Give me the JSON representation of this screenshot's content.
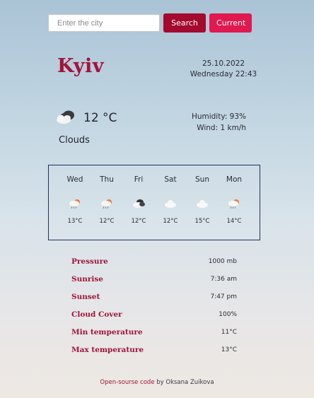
{
  "search": {
    "placeholder": "Enter the city",
    "search_label": "Search",
    "current_label": "Current"
  },
  "weather": {
    "city": "Kyiv",
    "date": "25.10.2022",
    "day_time": "Wednesday 22:43",
    "temperature": "12",
    "unit": "°C",
    "description": "Clouds",
    "humidity": "Humidity: 93%",
    "wind": "Wind: 1 km/h",
    "icon": "cloudy-night-icon"
  },
  "forecast": [
    {
      "day": "Wed",
      "temp": "13°C",
      "icon": "rain-sun-icon"
    },
    {
      "day": "Thu",
      "temp": "12°C",
      "icon": "rain-sun-icon"
    },
    {
      "day": "Fri",
      "temp": "12°C",
      "icon": "cloudy-night-icon"
    },
    {
      "day": "Sat",
      "temp": "12°C",
      "icon": "cloud-icon"
    },
    {
      "day": "Sun",
      "temp": "15°C",
      "icon": "cloud-icon"
    },
    {
      "day": "Mon",
      "temp": "14°C",
      "icon": "rain-sun-icon"
    }
  ],
  "stats": [
    {
      "label": "Pressure",
      "value": "1000 mb"
    },
    {
      "label": "Sunrise",
      "value": "7:36 am"
    },
    {
      "label": "Sunset",
      "value": "7:47 pm"
    },
    {
      "label": "Cloud Cover",
      "value": "100%"
    },
    {
      "label": "Min temperature",
      "value": "11°C"
    },
    {
      "label": "Max temperature",
      "value": "13°C"
    }
  ],
  "footer": {
    "link_text": "Open-sourse code",
    "author_text": " by Oksana Zuikova"
  },
  "colors": {
    "accent": "#a4092e",
    "accent_light": "#e0194e",
    "border": "#23315a"
  }
}
